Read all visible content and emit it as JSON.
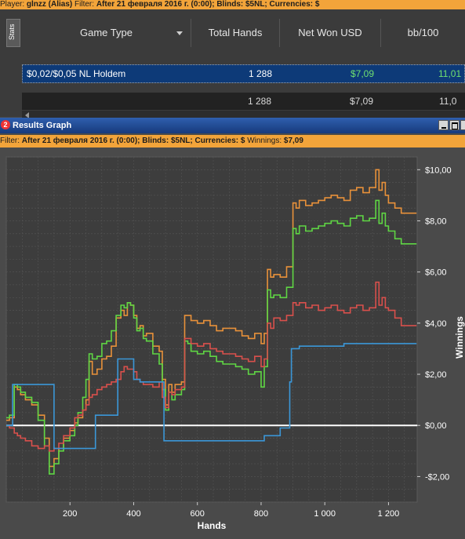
{
  "top_filter": {
    "player_label": "Player:",
    "player_value": "glnzz (Alias)",
    "filter_label": "Filter:",
    "filter_value": "After 21 февраля 2016 г. (0:00); Blinds: $5NL; Currencies: $"
  },
  "stats": {
    "tab_label": "Stats",
    "columns": [
      "Game Type",
      "Total Hands",
      "Net Won USD",
      "bb/100"
    ],
    "rows": [
      {
        "game": "$0,02/$0,05 NL Holdem",
        "hands": "1 288",
        "net": "$7,09",
        "bb": "11,01"
      }
    ],
    "total": {
      "hands": "1 288",
      "net": "$7,09",
      "bb": "11,0"
    }
  },
  "window": {
    "title": "Results Graph",
    "icon": "2"
  },
  "graph_filter": {
    "filter_label": "Filter:",
    "filter_value": "After 21 февраля 2016 г. (0:00); Blinds: $5NL; Currencies: $",
    "winnings_label": "Winnings:",
    "winnings_value": "$7,09"
  },
  "colors": {
    "orange": "#e8913a",
    "green": "#5fd644",
    "red": "#d9504c",
    "blue": "#3b97d8",
    "zero": "#ffffff"
  },
  "chart_data": {
    "type": "line",
    "xlabel": "Hands",
    "ylabel": "Winnings",
    "xlim": [
      0,
      1290
    ],
    "ylim": [
      -3,
      10.5
    ],
    "x_ticks": [
      200,
      400,
      600,
      800,
      1000,
      1200
    ],
    "x_tick_labels": [
      "200",
      "400",
      "600",
      "800",
      "1 000",
      "1 200"
    ],
    "y_ticks": [
      -2,
      0,
      2,
      4,
      6,
      8,
      10
    ],
    "y_tick_labels": [
      "-$2,00",
      "$0,00",
      "$2,00",
      "$4,00",
      "$6,00",
      "$8,00",
      "$10,00"
    ],
    "grid": true,
    "series": [
      {
        "color": "#e8913a",
        "x": [
          0,
          10,
          25,
          35,
          45,
          60,
          80,
          100,
          120,
          135,
          150,
          165,
          180,
          200,
          215,
          225,
          240,
          250,
          260,
          270,
          285,
          300,
          315,
          330,
          345,
          360,
          370,
          380,
          390,
          400,
          410,
          420,
          430,
          440,
          460,
          480,
          490,
          500,
          510,
          520,
          530,
          550,
          560,
          570,
          580,
          600,
          620,
          640,
          660,
          680,
          700,
          720,
          740,
          760,
          780,
          800,
          810,
          820,
          830,
          840,
          860,
          880,
          900,
          910,
          920,
          940,
          960,
          980,
          1000,
          1020,
          1040,
          1060,
          1080,
          1100,
          1120,
          1140,
          1160,
          1170,
          1180,
          1190,
          1200,
          1220,
          1240,
          1260,
          1280,
          1288
        ],
        "y": [
          0.2,
          0.3,
          1.5,
          1.4,
          1.2,
          1.0,
          0.8,
          0.4,
          -0.5,
          -1.6,
          -1.3,
          -0.9,
          -0.5,
          -0.2,
          0.1,
          0.3,
          0.6,
          1.0,
          2.5,
          2.0,
          2.2,
          2.6,
          2.7,
          3.1,
          4.2,
          4.5,
          4.3,
          4.8,
          4.7,
          4.3,
          3.8,
          3.9,
          3.5,
          3.6,
          3.1,
          2.9,
          1.8,
          0.8,
          1.6,
          1.3,
          1.6,
          1.7,
          4.3,
          4.3,
          4.1,
          4.0,
          4.1,
          3.9,
          3.7,
          3.8,
          3.8,
          3.7,
          3.5,
          3.4,
          3.6,
          3.2,
          3.6,
          6.1,
          5.8,
          5.9,
          5.8,
          6.2,
          8.7,
          8.5,
          8.8,
          8.6,
          8.7,
          8.8,
          8.9,
          9.0,
          8.9,
          8.8,
          9.2,
          9.3,
          9.1,
          9.3,
          10.0,
          9.2,
          9.5,
          9.0,
          8.7,
          8.5,
          8.3,
          8.3,
          8.3,
          8.3
        ]
      },
      {
        "color": "#5fd644",
        "x": [
          0,
          10,
          25,
          35,
          45,
          60,
          80,
          100,
          120,
          135,
          150,
          165,
          180,
          200,
          215,
          225,
          240,
          250,
          260,
          270,
          285,
          300,
          315,
          330,
          345,
          360,
          370,
          380,
          390,
          400,
          410,
          420,
          430,
          440,
          460,
          480,
          490,
          500,
          510,
          520,
          530,
          550,
          560,
          570,
          580,
          600,
          620,
          640,
          660,
          680,
          700,
          720,
          740,
          760,
          780,
          800,
          810,
          820,
          830,
          840,
          860,
          880,
          900,
          910,
          920,
          940,
          960,
          980,
          1000,
          1020,
          1040,
          1060,
          1080,
          1100,
          1120,
          1140,
          1160,
          1170,
          1180,
          1190,
          1200,
          1220,
          1240,
          1260,
          1280,
          1288
        ],
        "y": [
          0.3,
          0.4,
          1.6,
          1.5,
          1.3,
          1.1,
          0.9,
          0.2,
          -0.8,
          -1.9,
          -1.5,
          -1.0,
          -0.6,
          -0.4,
          0.0,
          0.5,
          1.1,
          1.8,
          2.8,
          2.6,
          2.7,
          3.2,
          3.3,
          3.7,
          4.3,
          4.7,
          4.6,
          4.8,
          4.7,
          4.2,
          3.7,
          3.8,
          3.4,
          3.3,
          2.8,
          2.4,
          1.4,
          0.6,
          1.3,
          1.0,
          1.2,
          1.4,
          3.3,
          3.2,
          2.9,
          2.8,
          2.9,
          2.7,
          2.5,
          2.4,
          2.4,
          2.3,
          2.2,
          2.0,
          2.1,
          1.5,
          2.3,
          5.3,
          5.0,
          5.1,
          5.0,
          5.4,
          7.7,
          7.5,
          7.8,
          7.6,
          7.7,
          7.8,
          7.9,
          8.0,
          7.9,
          7.8,
          8.1,
          8.2,
          8.0,
          8.1,
          8.8,
          7.9,
          8.3,
          7.8,
          7.6,
          7.3,
          7.1,
          7.1,
          7.1,
          7.1
        ]
      },
      {
        "color": "#d9504c",
        "x": [
          0,
          10,
          25,
          35,
          45,
          60,
          80,
          100,
          120,
          135,
          150,
          165,
          180,
          200,
          215,
          225,
          240,
          250,
          260,
          270,
          285,
          300,
          315,
          330,
          345,
          360,
          370,
          380,
          390,
          400,
          410,
          420,
          430,
          440,
          460,
          480,
          490,
          500,
          510,
          520,
          530,
          550,
          560,
          570,
          580,
          600,
          620,
          640,
          660,
          680,
          700,
          720,
          740,
          760,
          780,
          800,
          810,
          820,
          830,
          840,
          860,
          880,
          900,
          910,
          920,
          940,
          960,
          980,
          1000,
          1020,
          1040,
          1060,
          1080,
          1100,
          1120,
          1140,
          1160,
          1170,
          1180,
          1190,
          1200,
          1220,
          1240,
          1260,
          1280,
          1288
        ],
        "y": [
          0.0,
          -0.1,
          -0.3,
          -0.4,
          -0.5,
          -0.6,
          -0.8,
          -0.9,
          -0.8,
          -1.0,
          -0.9,
          -0.7,
          -0.4,
          -0.1,
          0.3,
          0.4,
          0.6,
          0.8,
          1.1,
          1.2,
          1.4,
          1.5,
          1.6,
          1.7,
          1.8,
          2.1,
          2.3,
          2.2,
          2.2,
          2.1,
          1.8,
          1.7,
          1.6,
          1.6,
          1.5,
          1.7,
          1.1,
          0.7,
          1.3,
          1.2,
          1.4,
          1.5,
          3.4,
          3.4,
          3.2,
          3.1,
          3.2,
          3.0,
          2.9,
          2.8,
          2.8,
          2.7,
          2.6,
          2.5,
          2.7,
          2.3,
          2.6,
          4.0,
          3.8,
          4.2,
          4.1,
          4.3,
          4.8,
          4.7,
          4.8,
          4.6,
          4.7,
          4.5,
          4.6,
          4.7,
          4.5,
          4.4,
          4.6,
          4.7,
          4.5,
          4.6,
          5.6,
          4.7,
          5.0,
          4.6,
          4.5,
          4.2,
          3.9,
          3.9,
          3.9,
          3.9
        ]
      },
      {
        "color": "#3b97d8",
        "x": [
          0,
          10,
          20,
          40,
          60,
          80,
          100,
          120,
          140,
          150,
          165,
          180,
          200,
          220,
          240,
          260,
          280,
          300,
          320,
          340,
          350,
          360,
          380,
          400,
          420,
          440,
          460,
          480,
          490,
          495,
          500,
          520,
          540,
          560,
          580,
          600,
          620,
          640,
          660,
          680,
          700,
          720,
          740,
          760,
          780,
          800,
          810,
          820,
          840,
          860,
          880,
          890,
          895,
          900,
          910,
          920,
          940,
          960,
          980,
          1000,
          1020,
          1040,
          1060,
          1080,
          1100,
          1120,
          1140,
          1160,
          1180,
          1200,
          1220,
          1240,
          1260,
          1280,
          1288
        ],
        "y": [
          0.0,
          0.0,
          1.6,
          1.6,
          1.6,
          1.6,
          1.6,
          1.6,
          1.6,
          -0.9,
          -0.9,
          -0.9,
          -0.9,
          -0.9,
          -0.9,
          -0.9,
          0.4,
          0.4,
          0.4,
          0.4,
          2.6,
          2.6,
          2.6,
          1.8,
          1.7,
          1.7,
          1.7,
          1.7,
          1.7,
          -0.6,
          -0.6,
          -0.6,
          -0.6,
          -0.6,
          -0.6,
          -0.6,
          -0.6,
          -0.6,
          -0.6,
          -0.6,
          -0.6,
          -0.6,
          -0.6,
          -0.6,
          -0.6,
          -0.6,
          -0.4,
          -0.4,
          -0.4,
          -0.1,
          -0.1,
          1.7,
          3.0,
          3.0,
          3.0,
          3.1,
          3.1,
          3.1,
          3.1,
          3.1,
          3.1,
          3.1,
          3.2,
          3.2,
          3.2,
          3.2,
          3.2,
          3.2,
          3.2,
          3.2,
          3.2,
          3.2,
          3.2,
          3.2,
          3.2
        ]
      }
    ]
  }
}
